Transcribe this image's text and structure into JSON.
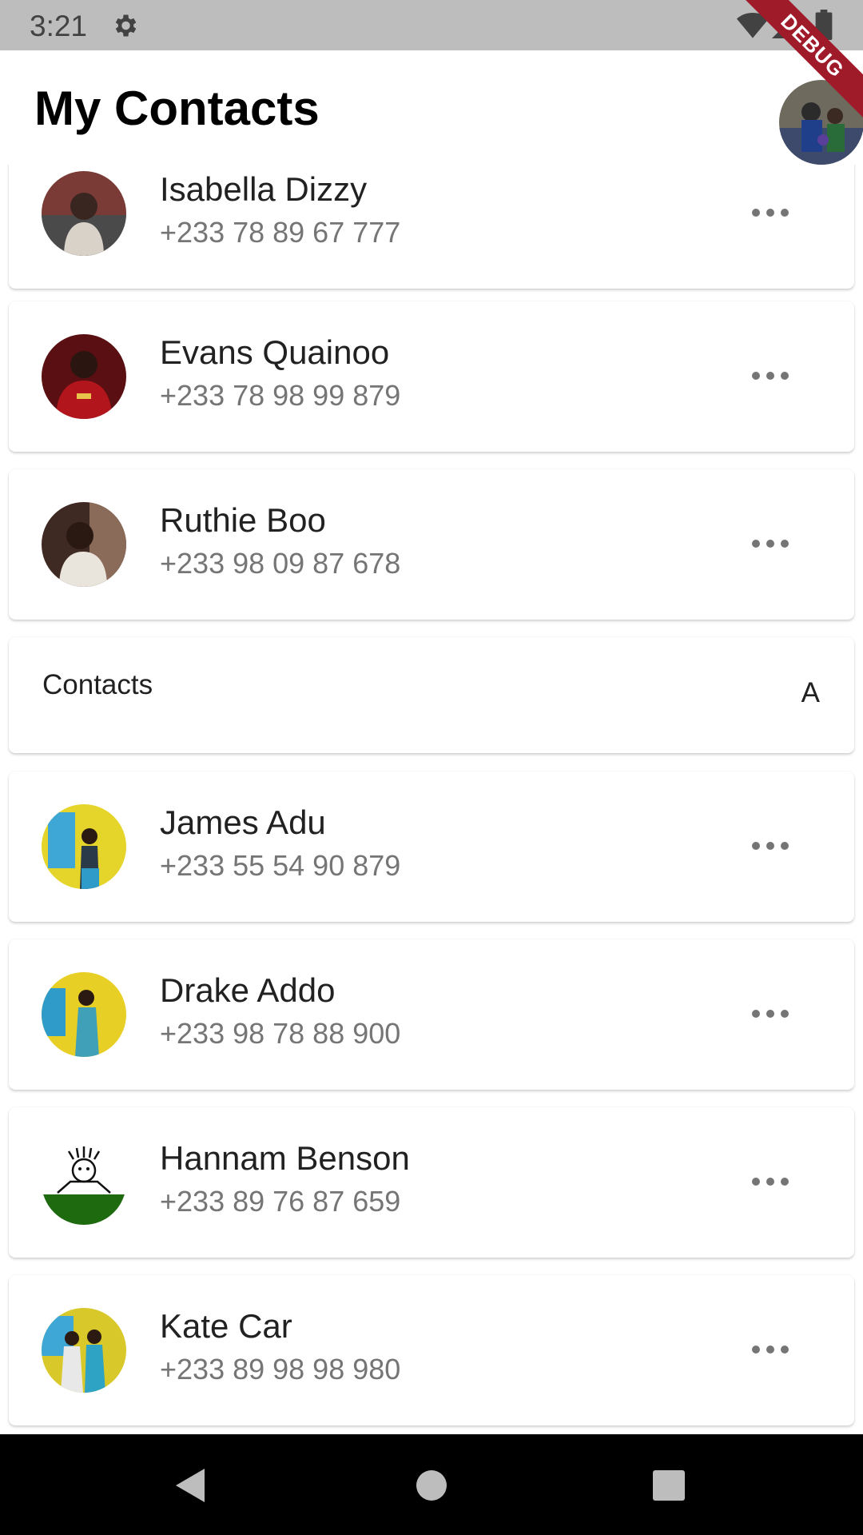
{
  "status_bar": {
    "time": "3:21",
    "icons": [
      "gear-icon",
      "wifi-icon",
      "signal-icon",
      "battery-icon"
    ]
  },
  "app_bar": {
    "title": "My Contacts",
    "debug_banner": "DEBUG"
  },
  "top_contacts": [
    {
      "name": "Isabella Dizzy",
      "phone": "+233 78 89 67 777"
    },
    {
      "name": "Evans Quainoo",
      "phone": "+233 78 98 99 879"
    },
    {
      "name": "Ruthie Boo",
      "phone": "+233 98 09 87 678"
    }
  ],
  "section": {
    "title": "Contacts",
    "letter": "A"
  },
  "contacts": [
    {
      "name": "James Adu",
      "phone": "+233 55 54 90 879"
    },
    {
      "name": "Drake Addo",
      "phone": "+233 98 78 88 900"
    },
    {
      "name": "Hannam Benson",
      "phone": "+233 89 76 87 659"
    },
    {
      "name": "Kate Car",
      "phone": "+233 89 98 98 980"
    }
  ],
  "nav_bar": {
    "icons": [
      "back-icon",
      "home-icon",
      "recent-apps-icon"
    ]
  },
  "colors": {
    "status_bar": "#bdbdbd",
    "phone_text": "#757575",
    "debug_ribbon": "#a01b2a",
    "nav_bar": "#000000"
  }
}
